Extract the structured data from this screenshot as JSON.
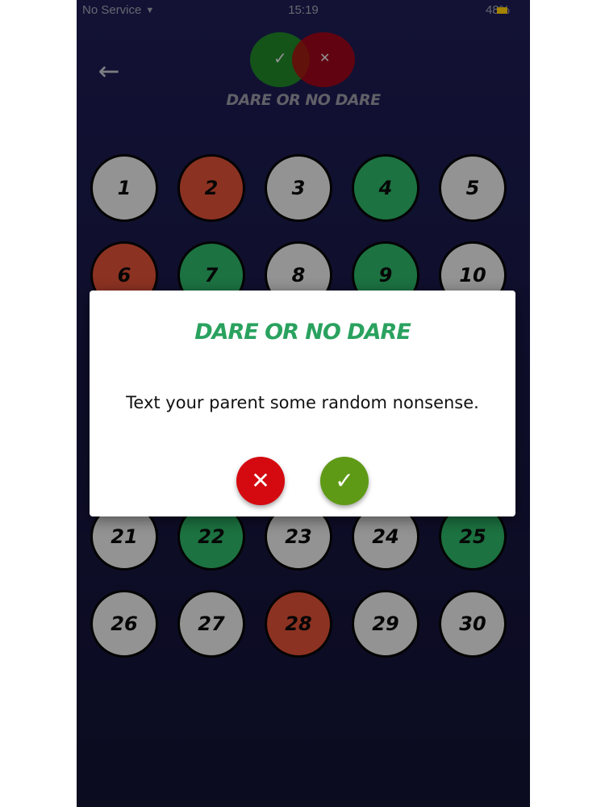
{
  "status_bar": {
    "carrier": "No Service",
    "time": "15:19",
    "battery": "48%"
  },
  "header": {
    "title": "DARE OR NO DARE",
    "logo_check": "✓",
    "logo_x": "✕",
    "back_icon": "←"
  },
  "grid": {
    "items": [
      {
        "number": "1",
        "state": "gray"
      },
      {
        "number": "2",
        "state": "red"
      },
      {
        "number": "3",
        "state": "gray"
      },
      {
        "number": "4",
        "state": "green"
      },
      {
        "number": "5",
        "state": "gray"
      },
      {
        "number": "6",
        "state": "red"
      },
      {
        "number": "7",
        "state": "green"
      },
      {
        "number": "8",
        "state": "gray"
      },
      {
        "number": "9",
        "state": "green"
      },
      {
        "number": "10",
        "state": "gray"
      },
      {
        "number": "21",
        "state": "gray"
      },
      {
        "number": "22",
        "state": "green"
      },
      {
        "number": "23",
        "state": "gray"
      },
      {
        "number": "24",
        "state": "gray"
      },
      {
        "number": "25",
        "state": "green"
      },
      {
        "number": "26",
        "state": "gray"
      },
      {
        "number": "27",
        "state": "gray"
      },
      {
        "number": "28",
        "state": "red"
      },
      {
        "number": "29",
        "state": "gray"
      },
      {
        "number": "30",
        "state": "gray"
      }
    ]
  },
  "modal": {
    "title": "DARE OR NO DARE",
    "message": "Text your parent some random nonsense.",
    "reject_icon": "✕",
    "accept_icon": "✓"
  },
  "colors": {
    "gray": "#d9d9d9",
    "red": "#cf4a33",
    "green": "#2aa861",
    "title_green": "#2aa25f",
    "reject_red": "#d40a10",
    "accept_green": "#5f9a17"
  }
}
